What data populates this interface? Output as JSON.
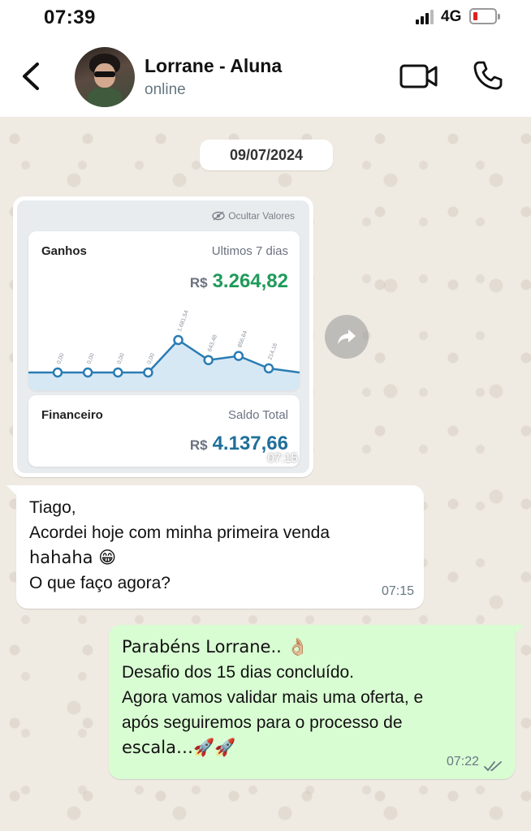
{
  "status_bar": {
    "time": "07:39",
    "network": "4G"
  },
  "header": {
    "contact_name": "Lorrane - Aluna",
    "contact_status": "online"
  },
  "chat": {
    "date_label": "09/07/2024",
    "image_message": {
      "hide_values_label": "Ocultar Valores",
      "ganhos": {
        "title": "Ganhos",
        "period": "Ultimos 7 dias",
        "currency": "R$",
        "value": "3.264,82"
      },
      "financeiro": {
        "title": "Financeiro",
        "subtitle": "Saldo Total",
        "currency": "R$",
        "value": "4.137,66"
      },
      "time": "07:15"
    },
    "incoming_message": {
      "lines": [
        "Tiago,",
        "Acordei hoje com minha primeira venda",
        "hahaha 😁",
        "O que faço agora?"
      ],
      "time": "07:15"
    },
    "outgoing_message": {
      "lines": [
        "Parabéns Lorrane.. 👌🏼",
        "Desafio dos 15 dias concluído.",
        "Agora vamos validar mais uma oferta, e",
        "após seguiremos para o processo de",
        "escala…🚀🚀"
      ],
      "time": "07:22"
    }
  },
  "chart_data": {
    "type": "line",
    "point_labels": [
      "0,00",
      "0,00",
      "0,00",
      "0,00",
      "1.681,54",
      "643,48",
      "856,64",
      "214,16"
    ],
    "values": [
      0,
      0,
      0,
      0,
      1681.54,
      643.48,
      856.64,
      214.16
    ],
    "colors": {
      "line": "#2a7cb4",
      "fill": "#bcd9ee"
    }
  }
}
